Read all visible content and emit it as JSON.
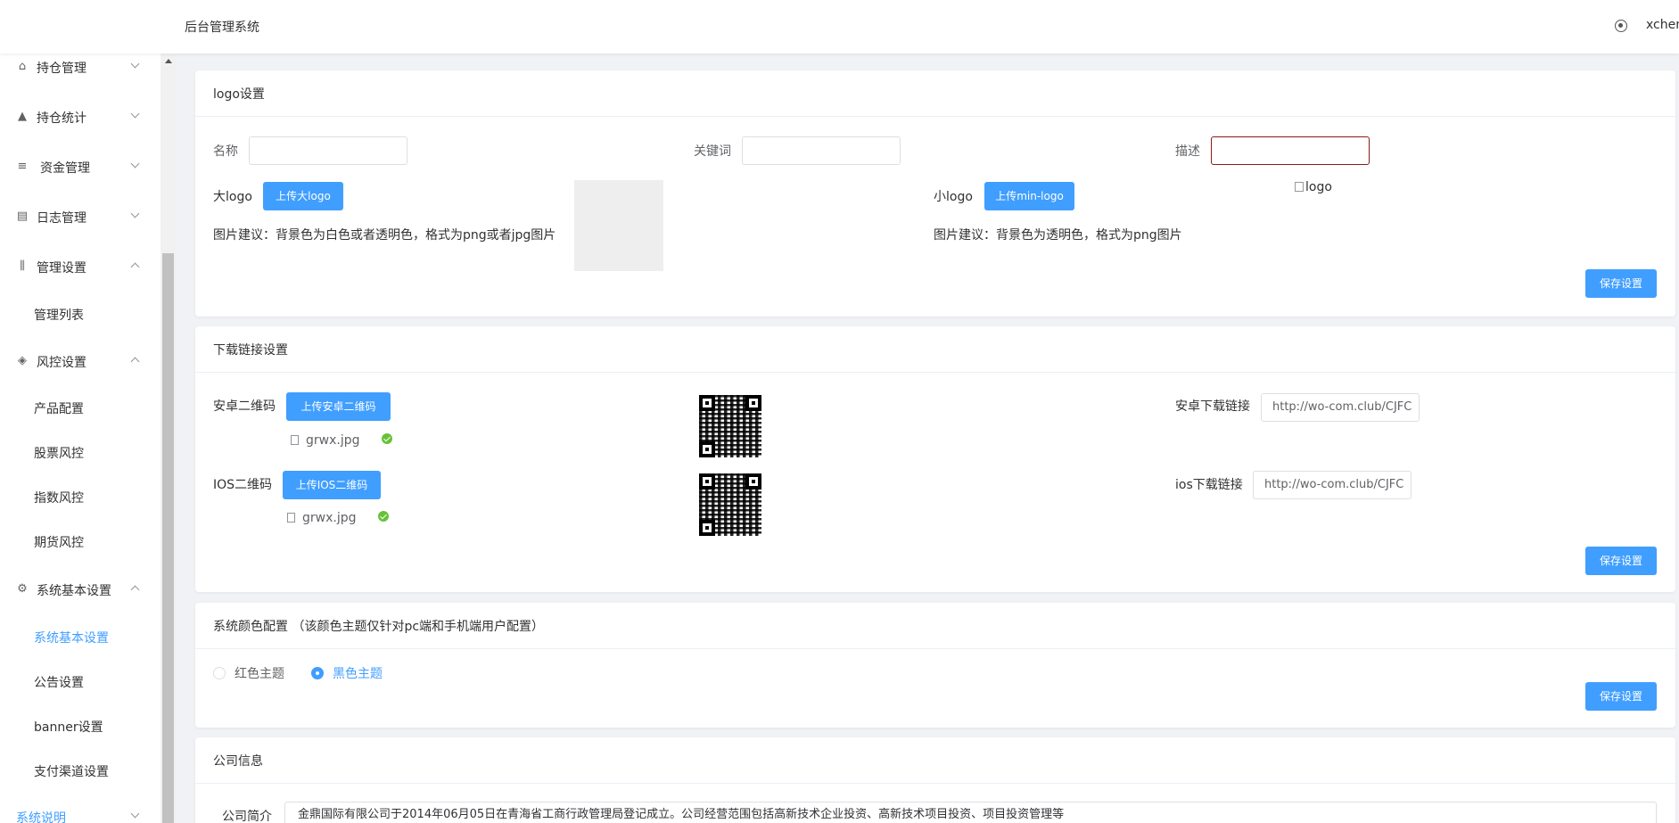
{
  "header": {
    "title": "后台管理系统",
    "username": "xchen"
  },
  "sidebar": {
    "items": [
      {
        "label": "持仓管理",
        "icon": "home-icon",
        "expanded": false
      },
      {
        "label": "持仓统计",
        "icon": "shirt-icon",
        "expanded": false
      },
      {
        "label": "资金管理",
        "icon": "database-icon",
        "expanded": false
      },
      {
        "label": "日志管理",
        "icon": "document-icon",
        "expanded": false
      },
      {
        "label": "管理设置",
        "icon": "sliders-icon",
        "expanded": true,
        "children": [
          "管理列表"
        ]
      },
      {
        "label": "风控设置",
        "icon": "shield-icon",
        "expanded": true,
        "children": [
          "产品配置",
          "股票风控",
          "指数风控",
          "期货风控"
        ]
      },
      {
        "label": "系统基本设置",
        "icon": "gear-icon",
        "expanded": true,
        "children": [
          "系统基本设置",
          "公告设置",
          "banner设置",
          "支付渠道设置"
        ],
        "active_child": "系统基本设置"
      },
      {
        "label": "系统说明",
        "icon": "info-icon",
        "expanded": false
      }
    ]
  },
  "logo_card": {
    "title": "logo设置",
    "name_label": "名称",
    "name_value": "",
    "keywords_label": "关键词",
    "keywords_value": "",
    "desc_label": "描述",
    "desc_value": "",
    "big_logo_label": "大logo",
    "big_logo_button": "上传大logo",
    "big_logo_hint": "图片建议：背景色为白色或者透明色，格式为png或者jpg图片",
    "small_logo_label": "小logo",
    "small_logo_button": "上传min-logo",
    "small_logo_hint": "图片建议：背景色为透明色，格式为png图片",
    "small_logo_alt": "logo",
    "save_button": "保存设置"
  },
  "download_card": {
    "title": "下载链接设置",
    "android_qr_label": "安卓二维码",
    "android_qr_button": "上传安卓二维码",
    "android_file": "grwx.jpg",
    "ios_qr_label": "IOS二维码",
    "ios_qr_button": "上传IOS二维码",
    "ios_file": "grwx.jpg",
    "android_link_label": "安卓下载链接",
    "android_link_value": "http://wo-com.club/CJFC",
    "ios_link_label": "ios下载链接",
    "ios_link_value": "http://wo-com.club/CJFC",
    "save_button": "保存设置"
  },
  "theme_card": {
    "title": "系统颜色配置 （该颜色主题仅针对pc端和手机端用户配置）",
    "options": [
      "红色主题",
      "黑色主题"
    ],
    "selected": "黑色主题",
    "save_button": "保存设置"
  },
  "company_card": {
    "title": "公司信息",
    "intro_label": "公司简介",
    "intro_value": "金鼎国际有限公司于2014年06月05日在青海省工商行政管理局登记成立。公司经营范围包括高新技术企业投资、高新技术项目投资、项目投资管理等"
  },
  "colors": {
    "primary": "#409eff",
    "success": "#67c23a",
    "focus_border": "#8b1a1a"
  }
}
